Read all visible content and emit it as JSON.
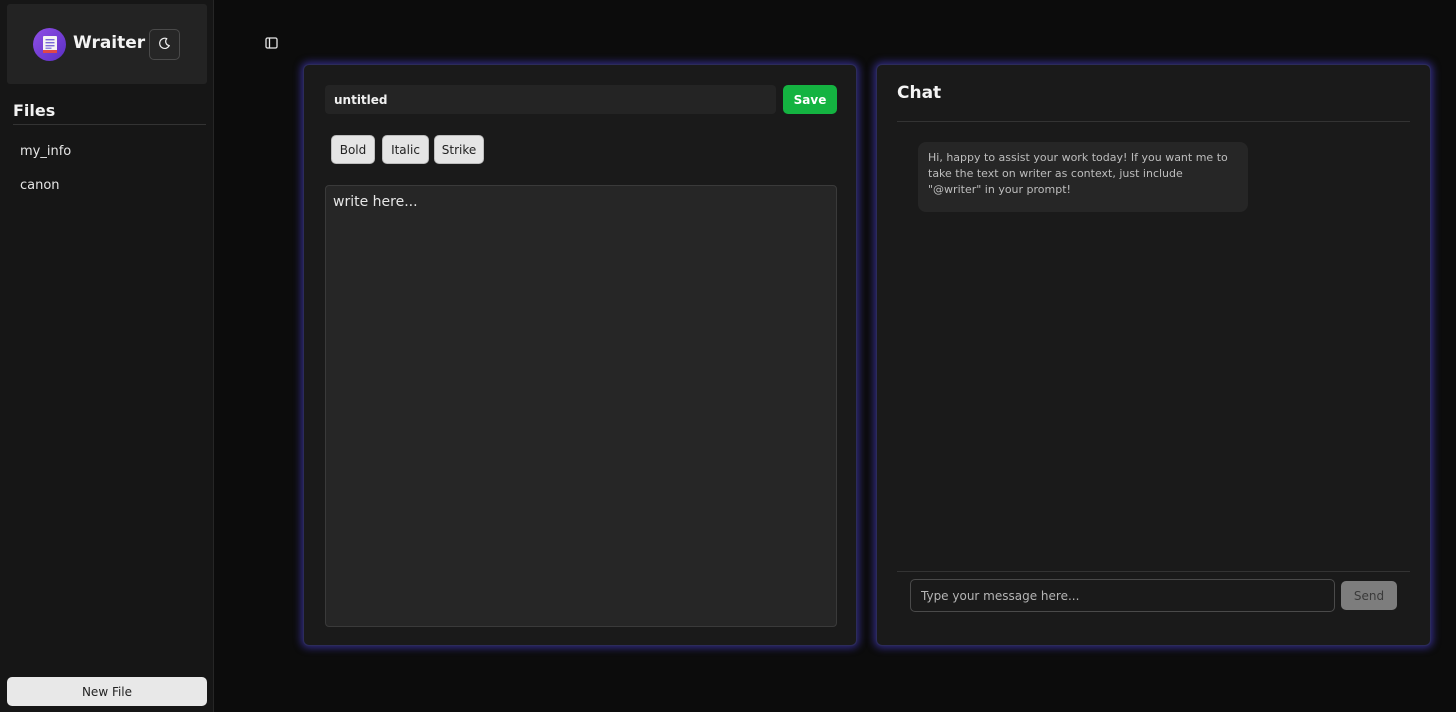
{
  "app": {
    "name": "Wraiter",
    "logo_icon": "document-icon",
    "theme_toggle_icon": "moon-icon",
    "accent_color": "#5b4ff0"
  },
  "sidebar": {
    "files_heading": "Files",
    "files": [
      {
        "label": "my_info"
      },
      {
        "label": "canon"
      }
    ],
    "new_file_label": "New File"
  },
  "editor": {
    "title_value": "untitled",
    "save_label": "Save",
    "save_color": "#14b341",
    "format_buttons": {
      "bold": "Bold",
      "italic": "Italic",
      "strike": "Strike"
    },
    "placeholder": "write here..."
  },
  "chat": {
    "title": "Chat",
    "messages": [
      {
        "text": "Hi, happy to assist your work today! If you want me to take the text on writer as context, just include \"@writer\" in your prompt!"
      }
    ],
    "input_placeholder": "Type your message here...",
    "send_label": "Send"
  }
}
